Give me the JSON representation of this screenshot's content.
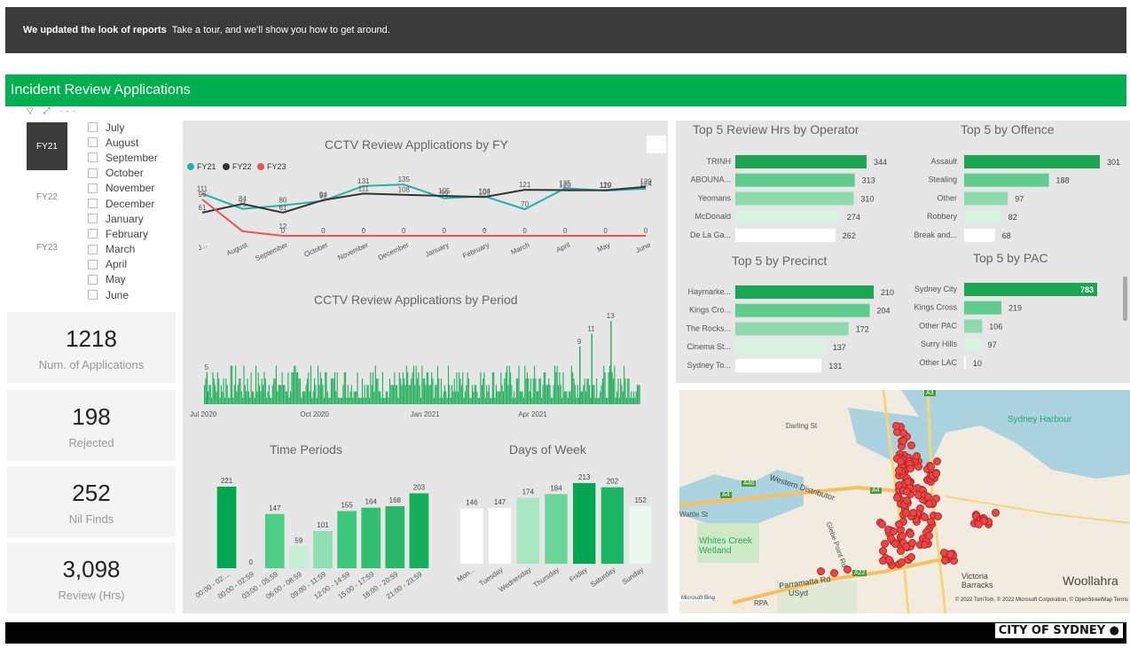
{
  "banner": {
    "bold": "We updated the look of reports",
    "text": "Take a tour, and we'll show you how to get around."
  },
  "report_title": "Incident Review Applications",
  "fy_slicer": [
    {
      "label": "FY21",
      "selected": true
    },
    {
      "label": "FY22",
      "selected": false
    },
    {
      "label": "FY23",
      "selected": false
    }
  ],
  "months": [
    "July",
    "August",
    "September",
    "October",
    "November",
    "December",
    "January",
    "February",
    "March",
    "April",
    "May",
    "June"
  ],
  "cards": [
    {
      "value": "1218",
      "label": "Num. of Applications"
    },
    {
      "value": "198",
      "label": "Rejected"
    },
    {
      "value": "252",
      "label": "Nil Finds"
    },
    {
      "value": "3,098",
      "label": "Review (Hrs)"
    }
  ],
  "colors": {
    "fy21": "#20b2aa",
    "fy22": "#333333",
    "fy23": "#ef5350",
    "accent": "#00b050",
    "map_pin": "#e84747"
  },
  "chart_data": [
    {
      "type": "line",
      "title": "CCTV Review Applications by FY",
      "categories": [
        "July",
        "August",
        "September",
        "October",
        "November",
        "December",
        "January",
        "February",
        "March",
        "April",
        "May",
        "June"
      ],
      "category_labels": [
        "J...",
        "August",
        "September",
        "October",
        "November",
        "December",
        "January",
        "February",
        "March",
        "April",
        "May",
        "June"
      ],
      "series": [
        {
          "name": "FY21",
          "values": [
            111,
            71,
            80,
            92,
            131,
            135,
            99,
            104,
            70,
            125,
            119,
            124
          ]
        },
        {
          "name": "FY22",
          "values": [
            61,
            84,
            61,
            94,
            111,
            108,
            105,
            102,
            121,
            120,
            120,
            129
          ]
        },
        {
          "name": "FY23",
          "values": [
            96,
            12,
            0,
            0,
            0,
            0,
            0,
            0,
            0,
            0,
            0,
            0
          ]
        }
      ],
      "data_labels": [
        {
          "text": "96",
          "m": 0,
          "v": 96
        },
        {
          "text": "111",
          "m": 0,
          "v": 111
        },
        {
          "text": "61",
          "m": 0,
          "v": 61
        },
        {
          "text": "84",
          "m": 1,
          "v": 84
        },
        {
          "text": "71",
          "m": 1,
          "v": 71
        },
        {
          "text": "12",
          "m": 2,
          "v": 12
        },
        {
          "text": "61",
          "m": 2,
          "v": 61
        },
        {
          "text": "80",
          "m": 2,
          "v": 80
        },
        {
          "text": "0",
          "m": 2,
          "v": 0
        },
        {
          "text": "94",
          "m": 3,
          "v": 94
        },
        {
          "text": "92",
          "m": 3,
          "v": 92
        },
        {
          "text": "0",
          "m": 3,
          "v": 0
        },
        {
          "text": "111",
          "m": 4,
          "v": 111
        },
        {
          "text": "131",
          "m": 4,
          "v": 131
        },
        {
          "text": "0",
          "m": 4,
          "v": 0
        },
        {
          "text": "108",
          "m": 5,
          "v": 108
        },
        {
          "text": "135",
          "m": 5,
          "v": 135
        },
        {
          "text": "0",
          "m": 5,
          "v": 0
        },
        {
          "text": "105",
          "m": 6,
          "v": 105
        },
        {
          "text": "99",
          "m": 6,
          "v": 99
        },
        {
          "text": "0",
          "m": 6,
          "v": 0
        },
        {
          "text": "102",
          "m": 7,
          "v": 102
        },
        {
          "text": "104",
          "m": 7,
          "v": 104
        },
        {
          "text": "0",
          "m": 7,
          "v": 0
        },
        {
          "text": "121",
          "m": 8,
          "v": 121
        },
        {
          "text": "70",
          "m": 8,
          "v": 70
        },
        {
          "text": "0",
          "m": 8,
          "v": 0
        },
        {
          "text": "120",
          "m": 9,
          "v": 120
        },
        {
          "text": "125",
          "m": 9,
          "v": 125
        },
        {
          "text": "0",
          "m": 9,
          "v": 0
        },
        {
          "text": "120",
          "m": 10,
          "v": 120
        },
        {
          "text": "119",
          "m": 10,
          "v": 119
        },
        {
          "text": "0",
          "m": 10,
          "v": 0
        },
        {
          "text": "129",
          "m": 11,
          "v": 129
        },
        {
          "text": "124",
          "m": 11,
          "v": 124
        },
        {
          "text": "0",
          "m": 11,
          "v": 0
        }
      ],
      "ylim": [
        0,
        140
      ]
    },
    {
      "type": "bar",
      "title": "CCTV Review Applications by Period",
      "x_ticks": [
        "Jul 2020",
        "Oct 2020",
        "Jan 2021",
        "Apr 2021"
      ],
      "x_range": [
        "2020-07-01",
        "2021-06-30"
      ],
      "ylim": [
        0,
        13
      ],
      "annotations": [
        {
          "text": "5",
          "date": "2020-07-03",
          "value": 5
        },
        {
          "text": "9",
          "date": "2021-05-10",
          "value": 9
        },
        {
          "text": "11",
          "date": "2021-05-20",
          "value": 11
        },
        {
          "text": "13",
          "date": "2021-06-05",
          "value": 13
        }
      ]
    },
    {
      "type": "bar",
      "title": "Time Periods",
      "categories": [
        "00:00 - 02:...",
        "00:00 - 02:59",
        "03:00 - 05:59",
        "06:00 - 08:59",
        "09:00 - 11:59",
        "12:00 - 14:59",
        "15:00 - 17:59",
        "18:00 - 20:59",
        "21:00 - 23:59"
      ],
      "values": [
        221,
        0,
        147,
        59,
        101,
        155,
        164,
        168,
        203
      ],
      "colors": [
        "#00a650",
        "#00a650",
        "#4ccf85",
        "#c6efd5",
        "#8fe0b1",
        "#3cc77b",
        "#31c072",
        "#27b869",
        "#14ad5c"
      ]
    },
    {
      "type": "bar",
      "title": "Days of Week",
      "categories": [
        "Mon...",
        "Tuesday",
        "Wednesday",
        "Thursday",
        "Friday",
        "Saturday",
        "Sunday"
      ],
      "values": [
        146,
        147,
        174,
        184,
        213,
        202,
        152
      ],
      "colors": [
        "#ffffff",
        "#ffffff",
        "#a7e8c2",
        "#69d597",
        "#00a650",
        "#1cb563",
        "#eaf8ef"
      ]
    },
    {
      "type": "bar",
      "title": "Top 5 Review Hrs by Operator",
      "categories": [
        "TRINH",
        "ABOUNA...",
        "Yeomans",
        "McDonald",
        "De La Ga..."
      ],
      "values": [
        344,
        313,
        310,
        274,
        262
      ]
    },
    {
      "type": "bar",
      "title": "Top 5 by Offence",
      "categories": [
        "Assault",
        "Stealing",
        "Other",
        "Robbery",
        "Break and..."
      ],
      "values": [
        301,
        188,
        97,
        82,
        68
      ]
    },
    {
      "type": "bar",
      "title": "Top 5 by Precinct",
      "categories": [
        "Haymarke...",
        "Kings Cro...",
        "The Rocks...",
        "Cinema St...",
        "Sydney To..."
      ],
      "values": [
        210,
        204,
        172,
        137,
        131
      ]
    },
    {
      "type": "bar",
      "title": "Top 5 by PAC",
      "categories": [
        "Sydney City",
        "Kings Cross",
        "Other PAC",
        "Surry Hills",
        "Other LAC"
      ],
      "values": [
        783,
        219,
        106,
        97,
        10
      ]
    }
  ],
  "map": {
    "labels": [
      "Sydney Harbour",
      "Darling St",
      "Western Distributor",
      "Whites Creek Wetland",
      "Parramatta Rd",
      "USyd",
      "RPA",
      "Victoria Barracks",
      "Woollahra",
      "A40",
      "A4",
      "A22",
      "A3",
      "Wattle St",
      "Glebe Point Rd"
    ],
    "copyright": "© 2022 TomTom, © 2022 Microsoft Corporation, © OpenStreetMap Terms",
    "bing": "Microsoft Bing"
  },
  "footer": {
    "logo": "CITY OF SYDNEY"
  }
}
